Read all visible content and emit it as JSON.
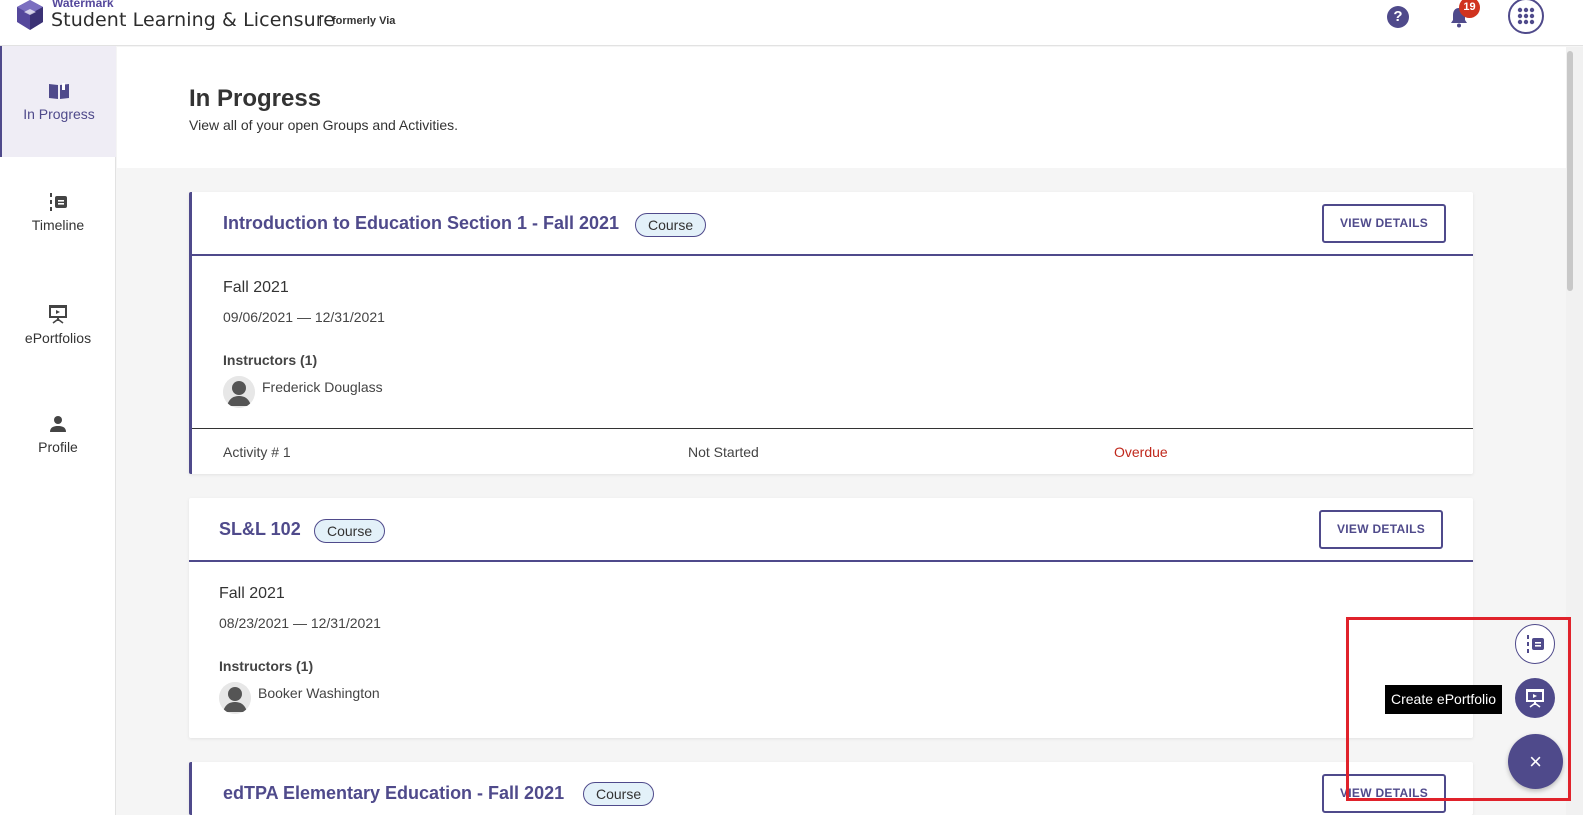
{
  "header": {
    "brand_small": "Watermark",
    "brand_tm": "™",
    "app_title": "Student Learning & Licensure",
    "formerly": "formerly Via",
    "help_label": "?",
    "notification_count": "19"
  },
  "sidebar": {
    "items": [
      {
        "label": "In Progress",
        "icon": "book-icon"
      },
      {
        "label": "Timeline",
        "icon": "timeline-icon"
      },
      {
        "label": "ePortfolios",
        "icon": "presentation-icon"
      },
      {
        "label": "Profile",
        "icon": "person-icon"
      }
    ]
  },
  "page": {
    "title": "In Progress",
    "subtitle": "View all of your open Groups and Activities."
  },
  "cards": [
    {
      "title": "Introduction to Education Section 1 - Fall 2021",
      "chip": "Course",
      "button": "VIEW DETAILS",
      "term": "Fall 2021",
      "dates": "09/06/2021 — 12/31/2021",
      "instructors_label": "Instructors (1)",
      "instructor": "Frederick Douglass",
      "activity": {
        "name": "Activity # 1",
        "status": "Not Started",
        "due": "Overdue"
      }
    },
    {
      "title": "SL&L 102",
      "chip": "Course",
      "button": "VIEW DETAILS",
      "term": "Fall 2021",
      "dates": "08/23/2021 — 12/31/2021",
      "instructors_label": "Instructors (1)",
      "instructor": "Booker Washington"
    },
    {
      "title": "edTPA Elementary Education - Fall 2021",
      "chip": "Course",
      "button": "VIEW DETAILS"
    }
  ],
  "fab": {
    "tooltip": "Create ePortfolio",
    "close_label": "×"
  },
  "colors": {
    "accent": "#4f4a8b",
    "overdue": "#c0281c",
    "badge": "#d0331f",
    "highlight": "#e0222b",
    "chip_bg": "#e3f1f9"
  }
}
